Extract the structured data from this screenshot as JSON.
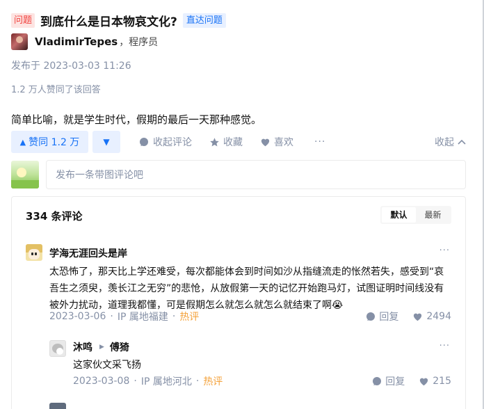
{
  "question": {
    "tag": "问题",
    "title": "到底什么是日本物哀文化?",
    "link": "直达问题"
  },
  "author": {
    "name": "VladimirTepes",
    "title": "，程序员"
  },
  "publish": "发布于 2023-03-03 11:26",
  "upvoted": "1.2 万人赞同了该回答",
  "answer": "简单比喻，就是学生时代，假期的最后一天那种感觉。",
  "actions": {
    "vote_up": "赞同 1.2 万",
    "vote_up_icon": "▲",
    "vote_down_icon": "▼",
    "collapse_comments": "收起评论",
    "favorite": "收藏",
    "like": "喜欢",
    "more": "···",
    "collapse": "收起"
  },
  "comment_input": {
    "placeholder": "发布一条带图评论吧"
  },
  "comments": {
    "count_label": "334 条评论",
    "sort": [
      "默认",
      "最新"
    ],
    "items": [
      {
        "author": "学海无涯回头是岸",
        "text": "太恐怖了，那天比上学还难受，每次都能体会到时间如沙从指缝流走的怅然若失，感受到“哀吾生之须臾，羡长江之无穷”的悲怆，从放假第一天的记忆开始跑马灯，试图证明时间线没有被外力扰动，道理我都懂，可是假期怎么就怎么就怎么就结束了啊😭",
        "date": "2023-03-06",
        "location": "IP 属地福建",
        "hot": "热评",
        "reply": "回复",
        "likes": "2494"
      },
      {
        "author": "沐鸣",
        "reply_to": "傅猗",
        "text": "这家伙文采飞扬",
        "date": "2023-03-08",
        "location": "IP 属地河北",
        "hot": "热评",
        "reply": "回复",
        "likes": "215"
      }
    ]
  },
  "colors": {
    "accent_blue": "#1772f6",
    "tag_red": "#f1403c",
    "hot_orange": "#f4a23b",
    "muted": "#8590a6"
  }
}
